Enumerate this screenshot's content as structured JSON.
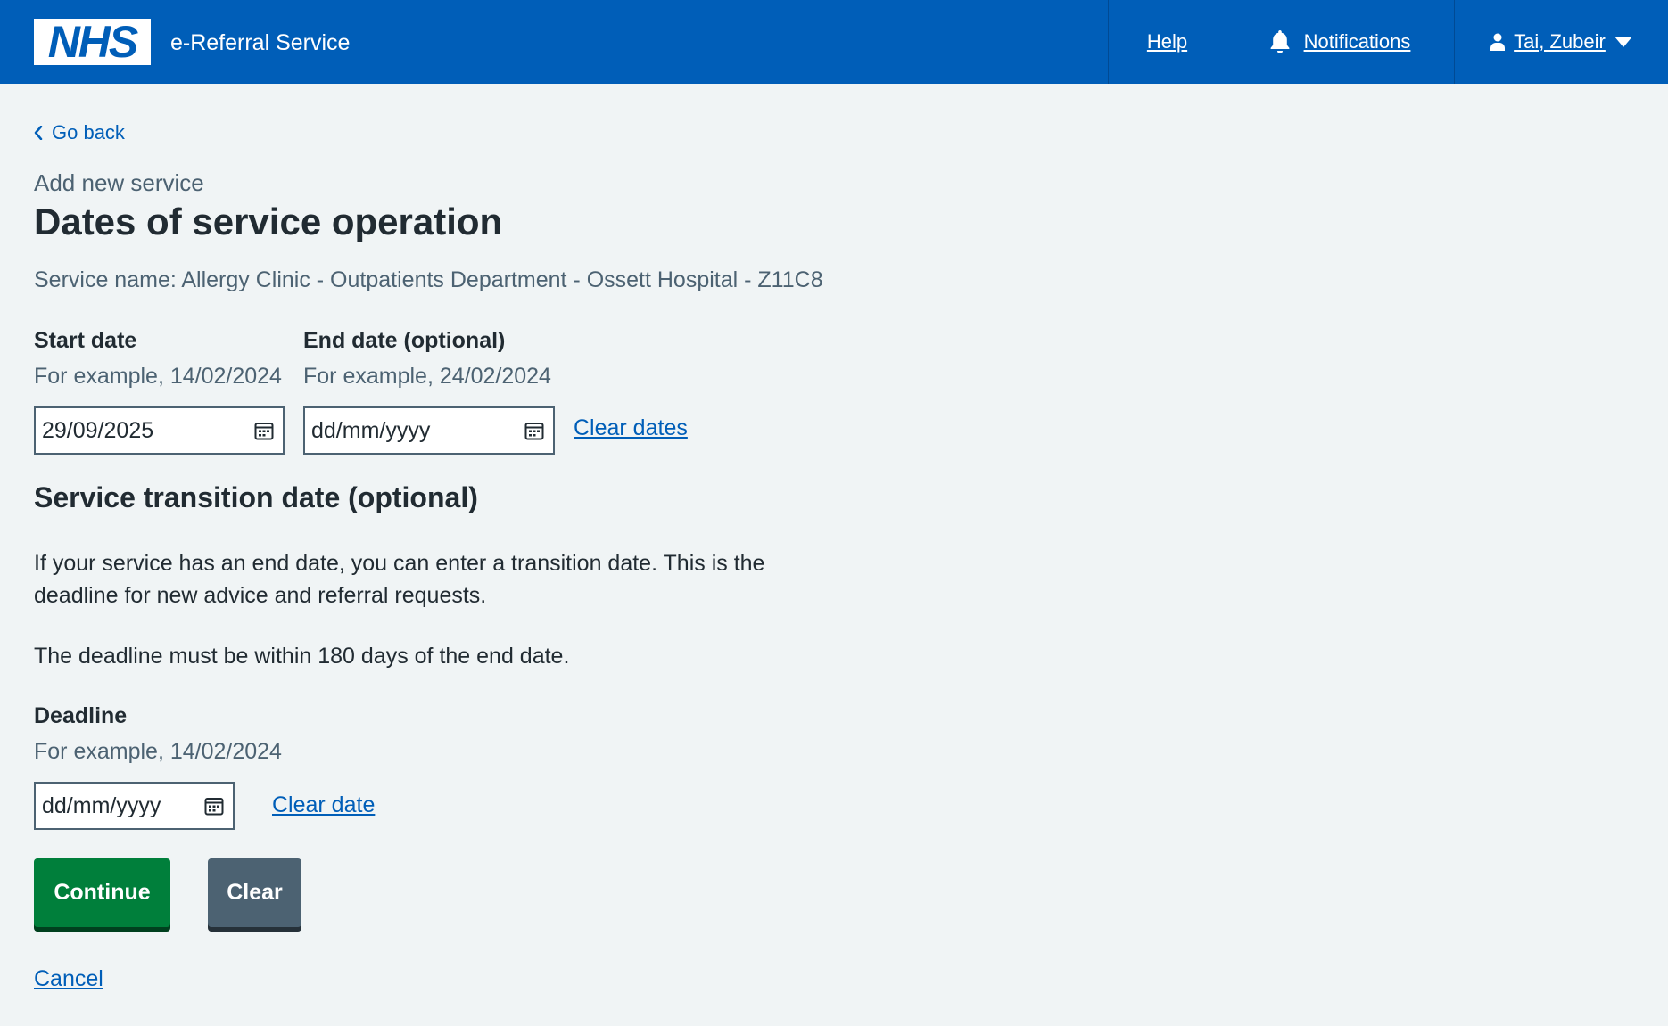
{
  "header": {
    "logo_text": "NHS",
    "service_name": "e-Referral Service",
    "nav": {
      "help": "Help",
      "notifications": "Notifications",
      "user": "Tai, Zubeir"
    }
  },
  "main": {
    "back_link": "Go back",
    "caption": "Add new service",
    "title": "Dates of service operation",
    "service_line": "Service name: Allergy Clinic - Outpatients Department - Ossett Hospital - Z11C8",
    "start_date": {
      "label": "Start date",
      "hint": "For example, 14/02/2024",
      "value": "29/09/2025",
      "placeholder": "dd/mm/yyyy"
    },
    "end_date": {
      "label": "End date (optional)",
      "hint": "For example, 24/02/2024",
      "value": "",
      "placeholder": "dd/mm/yyyy"
    },
    "clear_dates_link": "Clear dates",
    "transition": {
      "heading": "Service transition date (optional)",
      "paragraph1": "If your service has an end date, you can enter a transition date. This is the deadline for new advice and referral requests.",
      "paragraph2": "The deadline must be within 180 days of the end date."
    },
    "deadline": {
      "label": "Deadline",
      "hint": "For example, 14/02/2024",
      "value": "",
      "placeholder": "dd/mm/yyyy"
    },
    "clear_date_link": "Clear date",
    "buttons": {
      "continue": "Continue",
      "clear": "Clear"
    },
    "cancel_link": "Cancel"
  },
  "colors": {
    "header_blue": "#005eb8",
    "link_blue": "#005eb8",
    "continue_green": "#007f3b",
    "secondary_grey": "#4c6272",
    "background": "#f0f4f5"
  },
  "icons": [
    "bell-icon",
    "user-icon",
    "caret-down-icon",
    "chevron-left-icon",
    "calendar-icon"
  ]
}
